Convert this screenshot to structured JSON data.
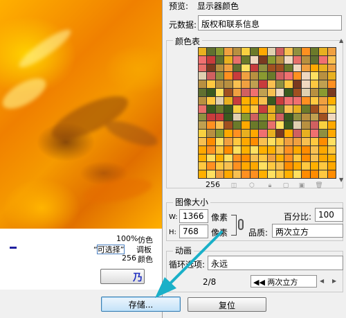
{
  "preview_info": {
    "dither_value": "100%",
    "dither_label": "仿色",
    "selectable_label": "“可选择”",
    "palette_label": "调板",
    "colors_value": "256",
    "colors_label": "颜色"
  },
  "preview_left_button": "",
  "right": {
    "preview_label": "预览:",
    "preview_value": "显示器颜色",
    "metadata_label": "元数据:",
    "metadata_value": "版权和联系信息",
    "color_table_title": "颜色表",
    "color_count": "256",
    "image_size_title": "图像大小",
    "width_label": "W:",
    "width_value": "1366",
    "width_unit": "像素",
    "height_label": "H:",
    "height_value": "768",
    "height_unit": "像素",
    "percent_label": "百分比:",
    "percent_value": "100",
    "quality_label": "品质:",
    "quality_value": "两次立方",
    "animation_title": "动画",
    "loop_label": "循环选项:",
    "loop_value": "永远",
    "frame_counter": "2/8",
    "frame_nav_value": "两次立方"
  },
  "buttons": {
    "save": "存储...",
    "reset": "复位"
  },
  "colors": {
    "accent_arrow": "#1ab0c8",
    "preview_orange": "#f59a00"
  },
  "icons": {
    "link": "chain-link-icon",
    "lock": "lock-icon",
    "trash": "trash-icon"
  }
}
